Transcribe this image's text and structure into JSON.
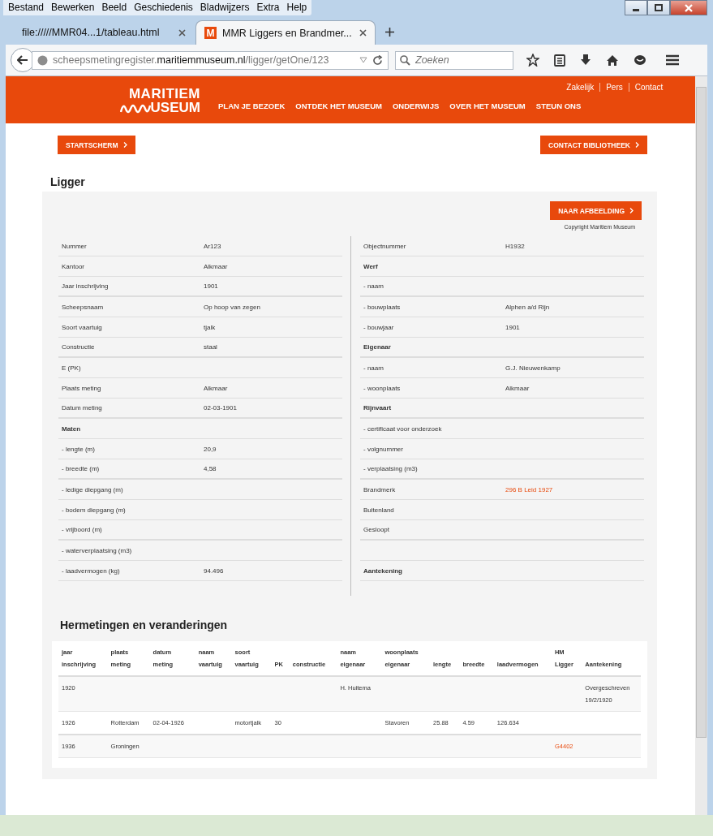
{
  "menu_bar": [
    "Bestand",
    "Bewerken",
    "Beeld",
    "Geschiedenis",
    "Bladwijzers",
    "Extra",
    "Help"
  ],
  "tabs": [
    {
      "label": "file://///MMR04...1/tableau.html",
      "selected": false
    },
    {
      "label": "MMR Liggers en Brandmer...",
      "selected": true,
      "favicon": "M"
    }
  ],
  "address_bar": {
    "host_prefix": "scheepsmetingregister.",
    "domain": "maritiemmuseum.nl",
    "path": "/ligger/getOne/123"
  },
  "search": {
    "placeholder": "Zoeken"
  },
  "site_header": {
    "logo_top": "MARITIEM",
    "logo_bottom": "USEUM",
    "top_links": [
      "Zakelijk",
      "Pers",
      "Contact"
    ],
    "nav": [
      "PLAN JE BEZOEK",
      "ONTDEK HET MUSEUM",
      "ONDERWIJS",
      "OVER HET MUSEUM",
      "STEUN ONS"
    ]
  },
  "buttons": {
    "left": "STARTSCHERM",
    "right": "CONTACT BIBLIOTHEEK"
  },
  "title": "Ligger",
  "image_button": "NAAR AFBEELDING",
  "copyright": "Copyright Maritiem Museum",
  "left_rows": [
    {
      "kind": "field",
      "label": "Nummer",
      "value": "Ar123"
    },
    {
      "kind": "field",
      "label": "Kantoor",
      "value": "Alkmaar"
    },
    {
      "kind": "field",
      "label": "Jaar inschrijving",
      "value": "1901"
    },
    {
      "kind": "field",
      "label": "Scheepsnaam",
      "value": "Op hoop van zegen"
    },
    {
      "kind": "field",
      "label": "Soort vaartuig",
      "value": "tjalk"
    },
    {
      "kind": "field",
      "label": "Constructie",
      "value": "staal"
    },
    {
      "kind": "field",
      "label": "E (PK)"
    },
    {
      "kind": "field",
      "label": "Plaats meting",
      "value": "Alkmaar"
    },
    {
      "kind": "field",
      "label": "Datum meting",
      "value": "02-03-1901"
    },
    {
      "kind": "heading",
      "label": "Maten"
    },
    {
      "kind": "field",
      "label": "- lengte (m)",
      "value": "20,9"
    },
    {
      "kind": "field",
      "label": "- breedte (m)",
      "value": "4,58"
    },
    {
      "kind": "field",
      "label": "- ledige diepgang (m)"
    },
    {
      "kind": "field",
      "label": "- bodem diepgang (m)"
    },
    {
      "kind": "field",
      "label": "- vrijboord (m)"
    },
    {
      "kind": "field",
      "label": "- waterverplaatsing (m3)"
    },
    {
      "kind": "field",
      "label": "- laadvermogen (kg)",
      "value": "94.496"
    }
  ],
  "right_rows": [
    {
      "kind": "field",
      "label": "Objectnummer",
      "value": "H1932"
    },
    {
      "kind": "heading",
      "label": "Werf"
    },
    {
      "kind": "field",
      "label": "- naam"
    },
    {
      "kind": "field",
      "label": "- bouwplaats",
      "value": "Alphen a/d Rijn"
    },
    {
      "kind": "field",
      "label": "- bouwjaar",
      "value": "1901"
    },
    {
      "kind": "heading",
      "label": "Eigenaar"
    },
    {
      "kind": "field",
      "label": "- naam",
      "value": "G.J. Nieuwenkamp"
    },
    {
      "kind": "field",
      "label": "- woonplaats",
      "value": "Alkmaar"
    },
    {
      "kind": "heading",
      "label": "Rijnvaart"
    },
    {
      "kind": "field",
      "label": "- certificaat voor onderzoek"
    },
    {
      "kind": "field",
      "label": "- volgnummer"
    },
    {
      "kind": "field",
      "label": "- verplaatsing (m3)"
    },
    {
      "kind": "link",
      "label": "Brandmerk",
      "value": "296 B Leid 1927"
    },
    {
      "kind": "field",
      "label": "Buitenland"
    },
    {
      "kind": "field",
      "label": "Gesloopt"
    },
    {
      "kind": "spacer"
    },
    {
      "kind": "heading",
      "label": "Aantekening"
    }
  ],
  "history": {
    "title": "Hermetingen en veranderingen",
    "columns": [
      "jaar\ninschrijving",
      "plaats\nmeting",
      "datum\nmeting",
      "naam\nvaartuig",
      "soort\nvaartuig",
      "PK",
      "constructie",
      "naam\neigenaar",
      "woonplaats\neigenaar",
      "lengte",
      "breedte",
      "laadvermogen",
      "HM\nLigger",
      "Aantekening"
    ],
    "rows": [
      {
        "cells": [
          "1920",
          null,
          null,
          null,
          null,
          null,
          null,
          "H. Huitema",
          null,
          null,
          null,
          null,
          null,
          "Overgeschreven 19/2/1920"
        ]
      },
      {
        "cells": [
          "1926",
          "Rotterdam",
          "02-04-1926",
          null,
          "motortjalk",
          "30",
          null,
          null,
          "Stavoren",
          "25.88",
          "4.59",
          "126.634",
          null,
          null
        ]
      },
      {
        "cells": [
          "1936",
          "Groningen",
          null,
          null,
          null,
          null,
          null,
          null,
          null,
          null,
          null,
          null,
          {
            "text": "G4402",
            "link": true
          },
          null
        ]
      }
    ]
  }
}
